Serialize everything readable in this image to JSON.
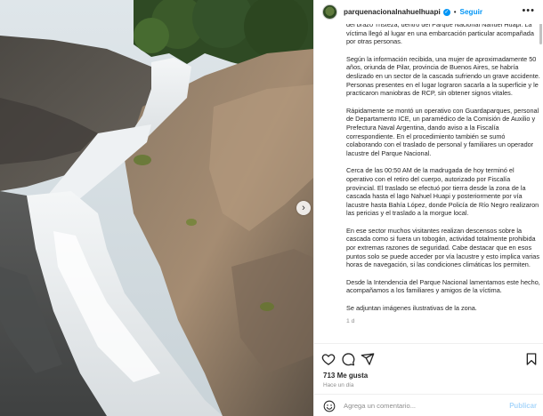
{
  "post": {
    "username": "parquenacionalnahuelhuapi",
    "separator": "•",
    "follow_label": "Seguir",
    "more_label": "•••",
    "next_label": "›"
  },
  "caption": {
    "paragraphs": [
      "del brazo Tristeza, dentro del Parque Nacional Nahuel Huapi. La víctima llegó al lugar en una embarcación particular acompañada por otras personas.",
      "Según la información recibida, una mujer de aproximadamente 50 años, oriunda de Pilar, provincia de Buenos Aires, se habría deslizado en un sector de la cascada sufriendo un grave accidente. Personas presentes en el lugar lograron sacarla a la superficie y le practicaron maniobras de RCP, sin obtener signos vitales.",
      "Rápidamente se montó un operativo con Guardaparques, personal de Departamento ICE, un paramédico de la Comisión de Auxilio y Prefectura Naval Argentina, dando aviso a la Fiscalía correspondiente. En el procedimiento también se sumó colaborando con el traslado de personal y familiares un operador lacustre del Parque Nacional.",
      "Cerca de las 00:50 AM de la madrugada de hoy terminó el operativo con el retiro del cuerpo, autorizado por Fiscalía provincial. El traslado se efectuó por tierra desde la zona de la cascada hasta el lago Nahuel Huapi y posteriormente por vía lacustre hasta Bahía López, donde Policía de Río Negro realizaron las pericias y el traslado a la morgue local.",
      "En ese sector muchos visitantes realizan descensos sobre la cascada como si fuera un tobogán, actividad totalmente prohibida por extremas razones de seguridad. Cabe destacar que en esos puntos solo se puede acceder por vía lacustre y esto implica varias horas de navegación, si las condiciones climáticas los permiten.",
      "Desde la Intendencia del Parque Nacional lamentamos este hecho, acompañamos a los familiares y amigos de la víctima.",
      "Se adjuntan imágenes ilustrativas de la zona."
    ],
    "time": "1 d"
  },
  "actions": {
    "likes": "713 Me gusta",
    "posted_ago": "Hace un día"
  },
  "comment": {
    "placeholder": "Agrega un comentario...",
    "publish_label": "Publicar"
  },
  "colors": {
    "link_blue": "#0095f6",
    "publish_disabled": "#a8d6fb",
    "muted": "#8e8e8e"
  },
  "icons": [
    "heart-icon",
    "comment-icon",
    "share-icon",
    "bookmark-icon",
    "emoji-icon",
    "verified-badge-icon",
    "more-options-icon",
    "chevron-right-icon"
  ]
}
